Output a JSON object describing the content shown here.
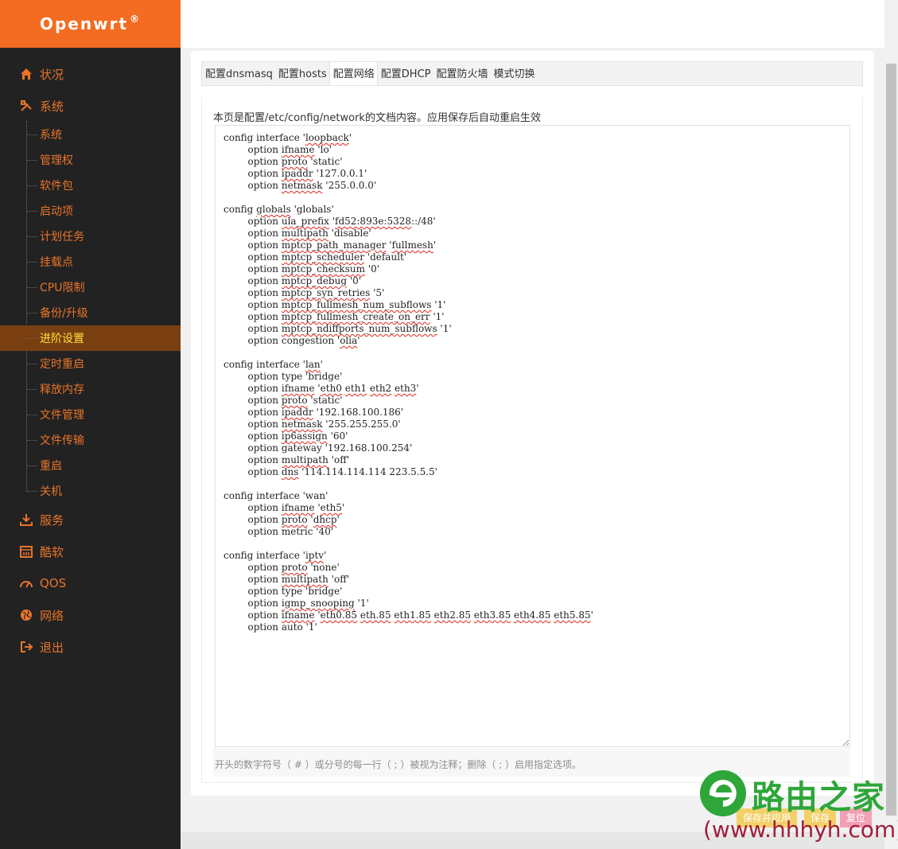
{
  "brand": {
    "name": "Openwrt",
    "mark": "®"
  },
  "sidebar": {
    "top": [
      {
        "label": "状况",
        "icon": "home-icon"
      },
      {
        "label": "系统",
        "icon": "tools-icon"
      },
      {
        "label": "服务",
        "icon": "download-icon"
      },
      {
        "label": "酷软",
        "icon": "calendar-icon"
      },
      {
        "label": "QOS",
        "icon": "gauge-icon"
      },
      {
        "label": "网络",
        "icon": "globe-icon"
      },
      {
        "label": "退出",
        "icon": "logout-icon"
      }
    ],
    "sub": [
      "系统",
      "管理权",
      "软件包",
      "启动项",
      "计划任务",
      "挂载点",
      "CPU限制",
      "备份/升级",
      "进阶设置",
      "定时重启",
      "释放内存",
      "文件管理",
      "文件传输",
      "重启",
      "关机"
    ],
    "active_sub": "进阶设置",
    "colors": {
      "bg": "#222222",
      "text": "#e8742a",
      "active_bg": "#7a3f10",
      "active_text": "#ffe03a",
      "brand": "#f36c21"
    }
  },
  "tabs": [
    "配置dnsmasq",
    "配置hosts",
    "配置网络",
    "配置DHCP",
    "配置防火墙",
    "模式切换"
  ],
  "active_tab": "配置网络",
  "description": "本页是配置/etc/config/network的文档内容。应用保存后自动重启生效",
  "editor": {
    "lines": [
      [
        [
          "config interface '",
          ""
        ],
        [
          "loopback",
          "s"
        ],
        [
          "'",
          ""
        ]
      ],
      [
        [
          "        option ",
          ""
        ],
        [
          "ifname",
          "s"
        ],
        [
          " 'lo'",
          ""
        ]
      ],
      [
        [
          "        option ",
          ""
        ],
        [
          "proto",
          "s"
        ],
        [
          " 'static'",
          ""
        ]
      ],
      [
        [
          "        option ",
          ""
        ],
        [
          "ipaddr",
          "s"
        ],
        [
          " '127.0.0.1'",
          ""
        ]
      ],
      [
        [
          "        option ",
          ""
        ],
        [
          "netmask",
          "s"
        ],
        [
          " '255.0.0.0'",
          ""
        ]
      ],
      [],
      [
        [
          "config ",
          ""
        ],
        [
          "globals",
          "s"
        ],
        [
          " 'globals'",
          ""
        ]
      ],
      [
        [
          "        option ",
          ""
        ],
        [
          "ula_prefix",
          "s"
        ],
        [
          " '",
          ""
        ],
        [
          "fd52:893e:5328",
          "s"
        ],
        [
          "::/48'",
          ""
        ]
      ],
      [
        [
          "        option ",
          ""
        ],
        [
          "multipath",
          "s"
        ],
        [
          " 'disable'",
          ""
        ]
      ],
      [
        [
          "        option ",
          ""
        ],
        [
          "mptcp_path_manager",
          "s"
        ],
        [
          " '",
          ""
        ],
        [
          "fullmesh",
          "s"
        ],
        [
          "'",
          ""
        ]
      ],
      [
        [
          "        option ",
          ""
        ],
        [
          "mptcp_scheduler",
          "s"
        ],
        [
          " 'default'",
          ""
        ]
      ],
      [
        [
          "        option ",
          ""
        ],
        [
          "mptcp_checksum",
          "s"
        ],
        [
          " '0'",
          ""
        ]
      ],
      [
        [
          "        option ",
          ""
        ],
        [
          "mptcp_debug",
          "s"
        ],
        [
          " '0'",
          ""
        ]
      ],
      [
        [
          "        option ",
          ""
        ],
        [
          "mptcp_syn_retries",
          "s"
        ],
        [
          " '5'",
          ""
        ]
      ],
      [
        [
          "        option ",
          ""
        ],
        [
          "mptcp_fullmesh_num_subflows",
          "s"
        ],
        [
          " '1'",
          ""
        ]
      ],
      [
        [
          "        option ",
          ""
        ],
        [
          "mptcp_fullmesh_create_on_err",
          "s"
        ],
        [
          " '1'",
          ""
        ]
      ],
      [
        [
          "        option ",
          ""
        ],
        [
          "mptcp_ndiffports_num_subflows",
          "s"
        ],
        [
          " '1'",
          ""
        ]
      ],
      [
        [
          "        option congestion '",
          ""
        ],
        [
          "olia",
          "s"
        ],
        [
          "'",
          ""
        ]
      ],
      [],
      [
        [
          "config interface '",
          ""
        ],
        [
          "lan",
          "s"
        ],
        [
          "'",
          ""
        ]
      ],
      [
        [
          "        option type 'bridge'",
          ""
        ]
      ],
      [
        [
          "        option ",
          ""
        ],
        [
          "ifname",
          "s"
        ],
        [
          " '",
          ""
        ],
        [
          "eth0",
          "s"
        ],
        [
          " ",
          ""
        ],
        [
          "eth1",
          "s"
        ],
        [
          " ",
          ""
        ],
        [
          "eth2",
          "s"
        ],
        [
          " ",
          ""
        ],
        [
          "eth3",
          "s"
        ],
        [
          "'",
          ""
        ]
      ],
      [
        [
          "        option ",
          ""
        ],
        [
          "proto",
          "s"
        ],
        [
          " 'static'",
          ""
        ]
      ],
      [
        [
          "        option ",
          ""
        ],
        [
          "ipaddr",
          "s"
        ],
        [
          " '192.168.100.186'",
          ""
        ]
      ],
      [
        [
          "        option ",
          ""
        ],
        [
          "netmask",
          "s"
        ],
        [
          " '255.255.255.0'",
          ""
        ]
      ],
      [
        [
          "        option ",
          ""
        ],
        [
          "ip6assign",
          "s"
        ],
        [
          " '60'",
          ""
        ]
      ],
      [
        [
          "        option gateway '192.168.100.254'",
          ""
        ]
      ],
      [
        [
          "        option ",
          ""
        ],
        [
          "multipath",
          "s"
        ],
        [
          " 'off'",
          ""
        ]
      ],
      [
        [
          "        option ",
          ""
        ],
        [
          "dns",
          "s"
        ],
        [
          " '114.114.114.114 223.5.5.5'",
          ""
        ]
      ],
      [],
      [
        [
          "config interface 'wan'",
          ""
        ]
      ],
      [
        [
          "        option ",
          ""
        ],
        [
          "ifname",
          "s"
        ],
        [
          " '",
          ""
        ],
        [
          "eth5",
          "s"
        ],
        [
          "'",
          ""
        ]
      ],
      [
        [
          "        option ",
          ""
        ],
        [
          "proto",
          "s"
        ],
        [
          " '",
          ""
        ],
        [
          "dhcp",
          "s"
        ],
        [
          "'",
          ""
        ]
      ],
      [
        [
          "        option metric '40'",
          ""
        ]
      ],
      [],
      [
        [
          "config interface '",
          ""
        ],
        [
          "iptv",
          "s"
        ],
        [
          "'",
          ""
        ]
      ],
      [
        [
          "        option ",
          ""
        ],
        [
          "proto",
          "s"
        ],
        [
          " 'none'",
          ""
        ]
      ],
      [
        [
          "        option ",
          ""
        ],
        [
          "multipath",
          "s"
        ],
        [
          " 'off'",
          ""
        ]
      ],
      [
        [
          "        option type 'bridge'",
          ""
        ]
      ],
      [
        [
          "        option ",
          ""
        ],
        [
          "igmp_snooping",
          "s"
        ],
        [
          " '1'",
          ""
        ]
      ],
      [
        [
          "        option ",
          ""
        ],
        [
          "ifname",
          "s"
        ],
        [
          " '",
          ""
        ],
        [
          "eth0.85",
          "s"
        ],
        [
          " ",
          ""
        ],
        [
          "eth.85",
          "s"
        ],
        [
          " ",
          ""
        ],
        [
          "eth1.85",
          "s"
        ],
        [
          " ",
          ""
        ],
        [
          "eth2.85",
          "s"
        ],
        [
          " ",
          ""
        ],
        [
          "eth3.85",
          "s"
        ],
        [
          " ",
          ""
        ],
        [
          "eth4.85",
          "s"
        ],
        [
          " ",
          ""
        ],
        [
          "eth5.85",
          "s"
        ],
        [
          "'",
          ""
        ]
      ],
      [
        [
          "        option auto '1'",
          ""
        ]
      ]
    ]
  },
  "hint": "开头的数字符号（ # ）或分号的每一行（ ; ）被视为注释；删除（ ; ）启用指定选项。",
  "buttons": {
    "save_apply": "保存并应用",
    "save": "保存",
    "reset": "复位"
  },
  "watermark": {
    "text": "路由之家",
    "url": "(www.hhhyh.com)"
  }
}
